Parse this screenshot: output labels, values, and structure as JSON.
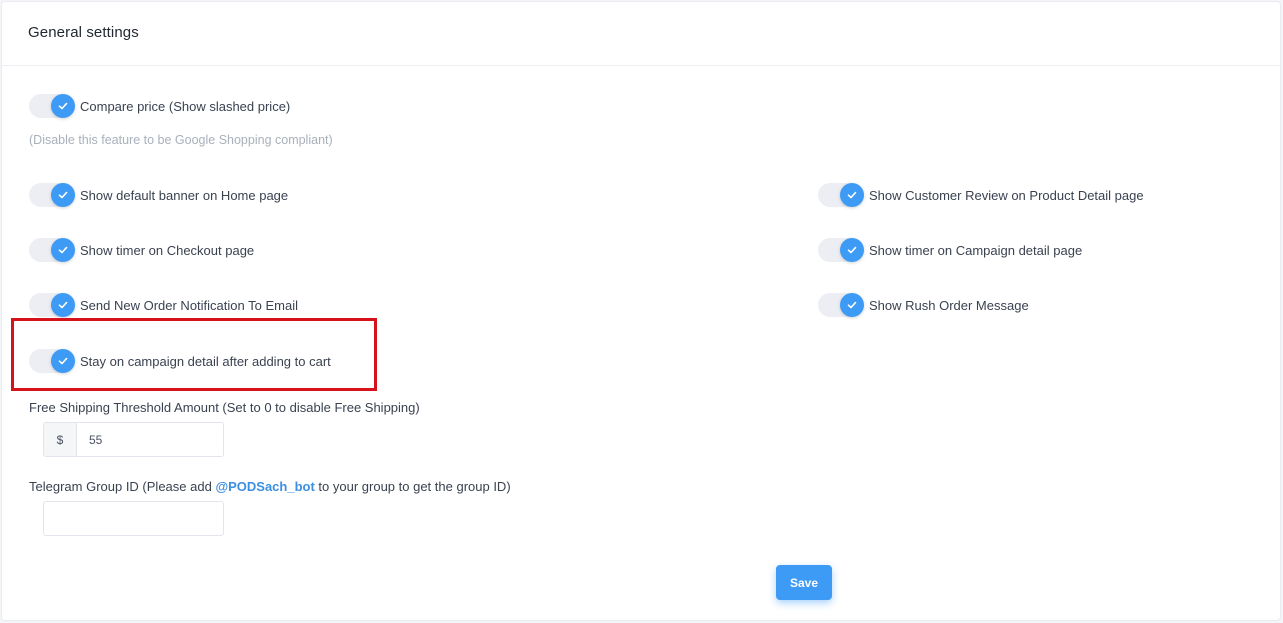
{
  "header": {
    "title": "General settings"
  },
  "toggles": {
    "compare_price": {
      "label": "Compare price (Show slashed price)",
      "checked": true
    },
    "default_banner": {
      "label": "Show default banner on Home page",
      "checked": true
    },
    "customer_review": {
      "label": "Show Customer Review on Product Detail page",
      "checked": true
    },
    "timer_checkout": {
      "label": "Show timer on Checkout page",
      "checked": true
    },
    "timer_campaign": {
      "label": "Show timer on Campaign detail page",
      "checked": true
    },
    "order_notification": {
      "label": "Send New Order Notification To Email",
      "checked": true
    },
    "rush_order": {
      "label": "Show Rush Order Message",
      "checked": true
    },
    "stay_on_campaign": {
      "label": "Stay on campaign detail after adding to cart",
      "checked": true
    }
  },
  "hint": {
    "compare_price_note": "(Disable this feature to be Google Shopping compliant)"
  },
  "free_shipping": {
    "label": "Free Shipping Threshold Amount (Set to 0 to disable Free Shipping)",
    "prefix": "$",
    "value": "55"
  },
  "telegram": {
    "label_before": "Telegram Group ID (Please add ",
    "handle": "@PODSach_bot",
    "label_after": " to your group to get the group ID)",
    "value": ""
  },
  "actions": {
    "save_label": "Save"
  },
  "colors": {
    "accent": "#3d9bf6",
    "highlight": "#d6121b"
  }
}
